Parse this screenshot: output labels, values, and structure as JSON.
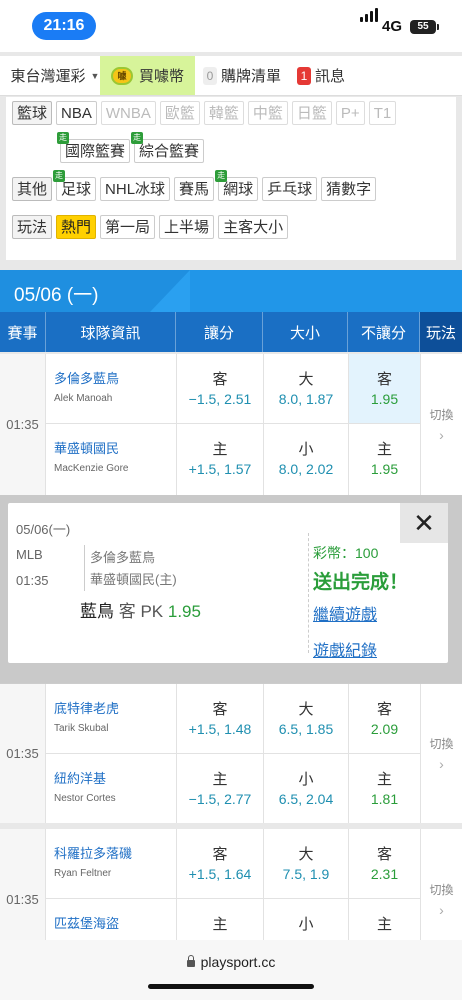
{
  "status": {
    "time": "21:16",
    "network": "4G",
    "battery": "55"
  },
  "nav": {
    "region": "東台灣運彩",
    "buy": "買噱幣",
    "coin_text": "噱",
    "cart_badge": "0",
    "cart": "購牌清單",
    "msg_badge": "1",
    "msg": "訊息"
  },
  "filters": {
    "basketball_label": "籃球",
    "basketball": [
      "NBA",
      "WNBA",
      "歐籃",
      "韓籃",
      "中籃",
      "日籃",
      "P+",
      "T1"
    ],
    "basketball2": [
      "國際籃賽",
      "綜合籃賽"
    ],
    "other_label": "其他",
    "other": [
      "足球",
      "NHL冰球",
      "賽馬",
      "網球",
      "乒乓球",
      "猜數字"
    ],
    "play_label": "玩法",
    "play": [
      "熱門",
      "第一局",
      "上半場",
      "主客大小"
    ],
    "zou": "走"
  },
  "date": "05/06 (一)",
  "table_headers": [
    "賽事",
    "球隊資訊",
    "讓分",
    "大小",
    "不讓分",
    "玩法"
  ],
  "games": [
    {
      "time": "01:35",
      "rows": [
        {
          "team": "多倫多藍鳥",
          "pitcher": "Alek Manoah",
          "spread_k": "客",
          "spread_o": "−1.5, 2.51",
          "total_k": "大",
          "total_o": "8.0, 1.87",
          "ml_k": "客",
          "ml_o": "1.95"
        },
        {
          "team": "華盛頓國民",
          "pitcher": "MacKenzie Gore",
          "spread_k": "主",
          "spread_o": "+1.5, 1.57",
          "total_k": "小",
          "total_o": "8.0, 2.02",
          "ml_k": "主",
          "ml_o": "1.95"
        }
      ],
      "switch": "切換"
    },
    {
      "time": "01:35",
      "rows": [
        {
          "team": "底特律老虎",
          "pitcher": "Tarik Skubal",
          "spread_k": "客",
          "spread_o": "+1.5, 1.48",
          "total_k": "大",
          "total_o": "6.5, 1.85",
          "ml_k": "客",
          "ml_o": "2.09"
        },
        {
          "team": "紐約洋基",
          "pitcher": "Nestor Cortes",
          "spread_k": "主",
          "spread_o": "−1.5, 2.77",
          "total_k": "小",
          "total_o": "6.5, 2.04",
          "ml_k": "主",
          "ml_o": "1.81"
        }
      ],
      "switch": "切換"
    },
    {
      "time": "01:35",
      "rows": [
        {
          "team": "科羅拉多落磯",
          "pitcher": "Ryan Feltner",
          "spread_k": "客",
          "spread_o": "+1.5, 1.64",
          "total_k": "大",
          "total_o": "7.5, 1.9",
          "ml_k": "客",
          "ml_o": "2.31"
        },
        {
          "team": "匹茲堡海盜",
          "pitcher": "",
          "spread_k": "主",
          "spread_o": "",
          "total_k": "小",
          "total_o": "",
          "ml_k": "主",
          "ml_o": ""
        }
      ],
      "switch": "切換"
    }
  ],
  "popup": {
    "date": "05/06(一)",
    "league": "MLB",
    "time": "01:35",
    "team1": "多倫多藍鳥",
    "team2": "華盛頓國民(主)",
    "pick_team": "藍鳥",
    "pick_side": "客 PK",
    "pick_odds": "1.95",
    "coins": "彩幣：100",
    "done": "送出完成！",
    "continue": "繼續遊戲",
    "history": "遊戲紀錄",
    "close": "✕"
  },
  "url": "playsport.cc",
  "colors": {
    "accent": "#1a6fc4",
    "buy_bg": "#d7f49a",
    "green": "#2a9d3a",
    "link": "#1f6fc5"
  }
}
